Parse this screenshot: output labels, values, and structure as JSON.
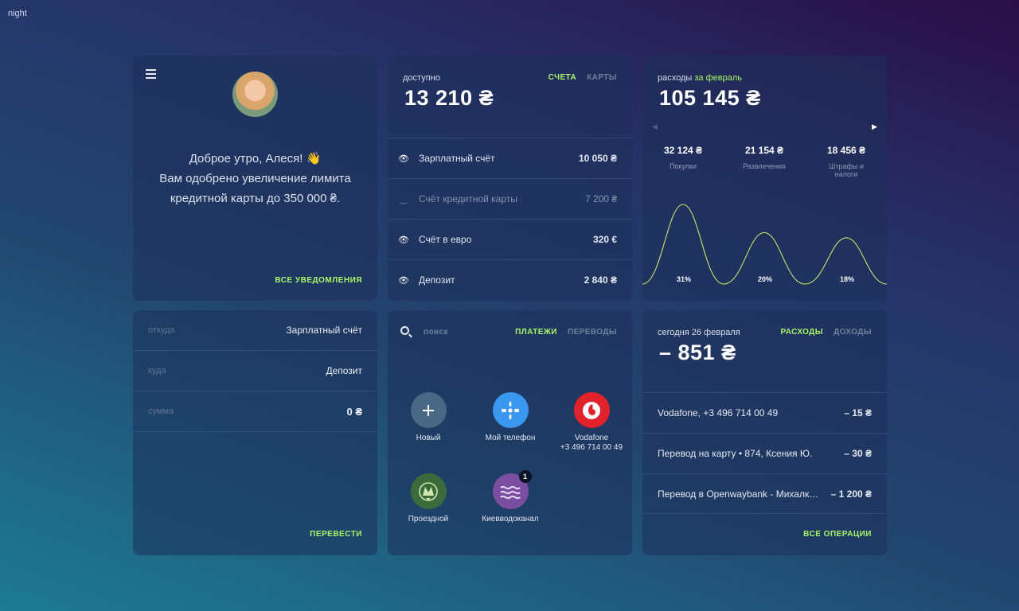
{
  "theme_label": "night",
  "colors": {
    "accent": "#a8f56a",
    "card": "#1e2f57"
  },
  "notifications": {
    "greeting_line1": "Доброе утро, Алеся! 👋",
    "greeting_line2": "Вам одобрено увеличение лимита",
    "greeting_line3": "кредитной карты до 350 000 ₴.",
    "all_link": "ВСЕ УВЕДОМЛЕНИЯ"
  },
  "accounts": {
    "label": "доступно",
    "amount": "13 210 ₴",
    "tab_accounts": "СЧЕТА",
    "tab_cards": "КАРТЫ",
    "items": [
      {
        "name": "Зарплатный счёт",
        "value": "10 050 ₴"
      },
      {
        "name": "Счёт кредитной карты",
        "value": "7 200 ₴"
      },
      {
        "name": "Счёт в евро",
        "value": "320 €"
      },
      {
        "name": "Депозит",
        "value": "2 840 ₴"
      }
    ]
  },
  "expenses": {
    "label": "расходы",
    "period": "за февраль",
    "amount": "105 145 ₴",
    "categories": [
      {
        "value": "32 124 ₴",
        "name": "Покупки",
        "pct": "31%",
        "fraction": 0.31
      },
      {
        "value": "21 154 ₴",
        "name": "Развлечения",
        "pct": "20%",
        "fraction": 0.2
      },
      {
        "value": "18 456 ₴",
        "name": "Штрафы и налоги",
        "pct": "18%",
        "fraction": 0.18
      }
    ]
  },
  "transfer": {
    "from_label": "откуда",
    "from_value": "Зарплатный счёт",
    "to_label": "куда",
    "to_value": "Депозит",
    "sum_label": "сумма",
    "sum_value": "0 ₴",
    "action": "ПЕРЕВЕСТИ"
  },
  "payments": {
    "search_placeholder": "поиск",
    "tab_payments": "ПЛАТЕЖИ",
    "tab_transfers": "ПЕРЕВОДЫ",
    "items": [
      {
        "label": "Новый",
        "icon": "plus-icon",
        "color": "#4a6785"
      },
      {
        "label": "Мой телефон",
        "icon": "kyivstar-icon",
        "color": "#3a97ef"
      },
      {
        "label": "Vodafone",
        "sublabel": "+3 496 714 00 49",
        "icon": "vodafone-icon",
        "color": "#e2222a"
      },
      {
        "label": "Проездной",
        "icon": "metro-icon",
        "color": "#3d6a3a"
      },
      {
        "label": "Киевводоканал",
        "icon": "wave-icon",
        "color": "#7a4ea0",
        "badge": "1"
      }
    ]
  },
  "today": {
    "label": "сегодня 26 февраля",
    "amount": "– 851 ₴",
    "tab_expenses": "РАСХОДЫ",
    "tab_income": "ДОХОДЫ",
    "operations": [
      {
        "desc": "Vodafone, +3 496 714 00 49",
        "value": "– 15 ₴"
      },
      {
        "desc": "Перевод на карту  • 874, Ксения Ю.",
        "value": "– 30 ₴"
      },
      {
        "desc": "Перевод в Openwaybank - Михалко…",
        "value": "– 1 200 ₴"
      }
    ],
    "all_link": "ВСЕ ОПЕРАЦИИ"
  }
}
